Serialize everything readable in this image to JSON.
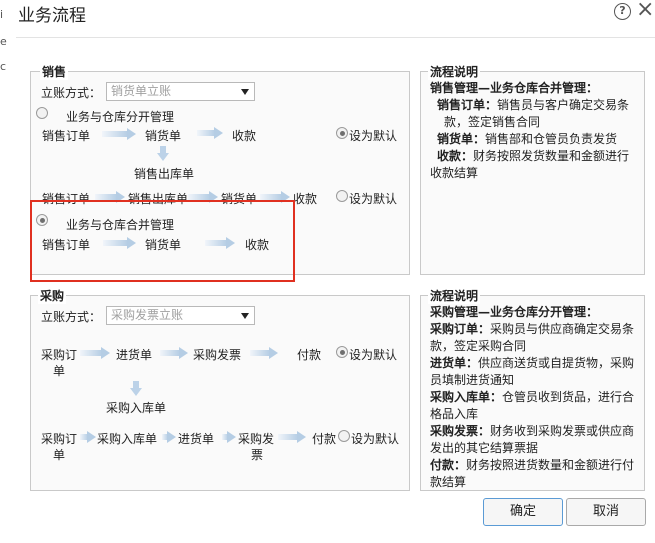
{
  "dialog": {
    "title": "业务流程",
    "help_icon": "?",
    "close_icon": "×",
    "edge_marks": [
      "i",
      "e",
      "c"
    ]
  },
  "sales": {
    "title": "销售",
    "account_label": "立账方式：",
    "account_value": "销货单立账",
    "option_split": {
      "label": "业务与仓库分开管理",
      "flow_row1": [
        "销售订单",
        "销货单",
        "收款"
      ],
      "default_label": "设为默认",
      "branch": "销售出库单",
      "flow_row2": [
        "销售订单",
        "销售出库单",
        "销货单",
        "收款"
      ],
      "default_label2": "设为默认"
    },
    "option_merged": {
      "label": "业务与仓库合并管理",
      "flow": [
        "销售订单",
        "销货单",
        "收款"
      ]
    }
  },
  "sales_desc": {
    "title": "流程说明",
    "heading": "销售管理—业务仓库合并管理：",
    "items": [
      {
        "label": "销售订单：",
        "lines": [
          "销售员与客户确定交易条",
          "款，签定销售合同"
        ]
      },
      {
        "label": "销货单：",
        "lines": [
          "销售部和仓管员负责发货"
        ]
      },
      {
        "label": "收款：",
        "lines": [
          "财务按照发货数量和金额进行",
          "收款结算"
        ]
      }
    ]
  },
  "purchase": {
    "title": "采购",
    "account_label": "立账方式：",
    "account_value": "采购发票立账",
    "flow_row1": [
      "采购订",
      "单",
      "进货单",
      "采购发票",
      "付款"
    ],
    "default_label": "设为默认",
    "branch": "采购入库单",
    "flow_row2": [
      "采购订",
      "单",
      "采购入库单",
      "进货单",
      "采购发",
      "票",
      "付款"
    ],
    "default_label2": "设为默认"
  },
  "purchase_desc": {
    "title": "流程说明",
    "heading": "采购管理—业务仓库分开管理：",
    "items": [
      {
        "label": "采购订单：",
        "lines": [
          "采购员与供应商确定交易条",
          "款，签定采购合同"
        ]
      },
      {
        "label": "进货单：",
        "lines": [
          "供应商送货或自提货物，采购",
          "员填制进货通知"
        ]
      },
      {
        "label": "采购入库单：",
        "lines": [
          "仓管员收到货品，进行合",
          "格品入库"
        ]
      },
      {
        "label": "采购发票：",
        "lines": [
          "财务收到采购发票或供应商",
          "发出的其它结算票据"
        ]
      },
      {
        "label": "付款：",
        "lines": [
          "财务按照进货数量和金额进行付",
          "款结算"
        ]
      }
    ]
  },
  "buttons": {
    "ok": "确定",
    "cancel": "取消"
  },
  "colors": {
    "highlight_border": "#e03020",
    "primary_button_border": "#5b9bd5",
    "arrow": "#b5cde4"
  }
}
